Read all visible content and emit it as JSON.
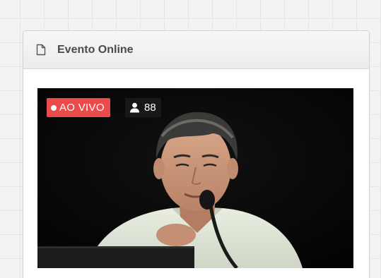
{
  "panel": {
    "title": "Evento Online",
    "title_icon": "document-icon"
  },
  "video": {
    "live_label": "AO VIVO",
    "viewer_count": "88",
    "viewer_icon": "user-icon",
    "live_color": "#ec4b4b"
  }
}
